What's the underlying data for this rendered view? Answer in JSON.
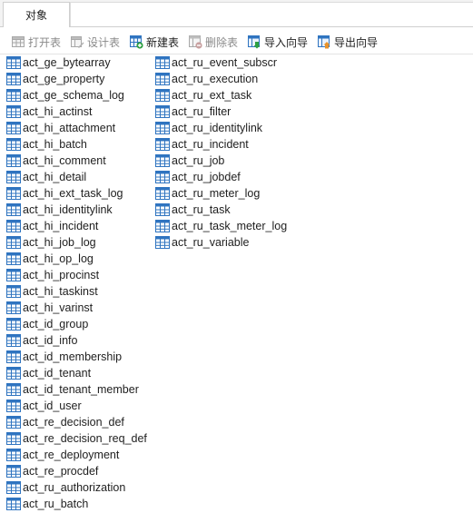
{
  "tabs": {
    "objects_label": "对象"
  },
  "toolbar": {
    "open_table": "打开表",
    "design_table": "设计表",
    "new_table": "新建表",
    "delete_table": "删除表",
    "import_wizard": "导入向导",
    "export_wizard": "导出向导"
  },
  "tables_col1": [
    "act_ge_bytearray",
    "act_ge_property",
    "act_ge_schema_log",
    "act_hi_actinst",
    "act_hi_attachment",
    "act_hi_batch",
    "act_hi_comment",
    "act_hi_detail",
    "act_hi_ext_task_log",
    "act_hi_identitylink",
    "act_hi_incident",
    "act_hi_job_log",
    "act_hi_op_log",
    "act_hi_procinst",
    "act_hi_taskinst",
    "act_hi_varinst",
    "act_id_group",
    "act_id_info",
    "act_id_membership",
    "act_id_tenant",
    "act_id_tenant_member",
    "act_id_user",
    "act_re_decision_def",
    "act_re_decision_req_def",
    "act_re_deployment",
    "act_re_procdef",
    "act_ru_authorization",
    "act_ru_batch"
  ],
  "tables_col2": [
    "act_ru_event_subscr",
    "act_ru_execution",
    "act_ru_ext_task",
    "act_ru_filter",
    "act_ru_identitylink",
    "act_ru_incident",
    "act_ru_job",
    "act_ru_jobdef",
    "act_ru_meter_log",
    "act_ru_task",
    "act_ru_task_meter_log",
    "act_ru_variable"
  ],
  "icons": {
    "table": "table-icon",
    "open": "open-table-icon",
    "design": "design-table-icon",
    "new": "new-table-icon",
    "delete": "delete-table-icon",
    "import": "import-wizard-icon",
    "export": "export-wizard-icon"
  },
  "colors": {
    "table_icon_blue": "#2f74c0",
    "add_green": "#2ea043",
    "delete_red": "#d93a3a",
    "export_orange": "#e8922a"
  }
}
